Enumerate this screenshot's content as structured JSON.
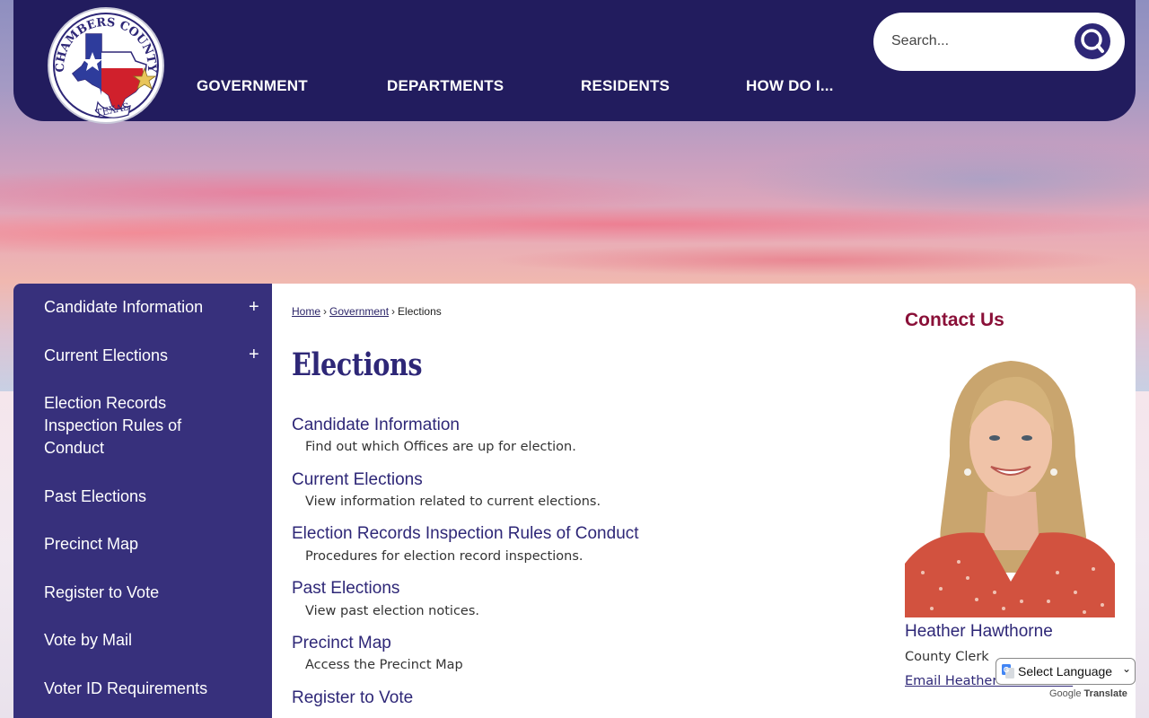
{
  "header": {
    "logo_text_top": "CHAMBERS COUNTY",
    "logo_text_bottom": "TEXAS",
    "nav": [
      "GOVERNMENT",
      "DEPARTMENTS",
      "RESIDENTS",
      "HOW DO I..."
    ],
    "search_placeholder": "Search..."
  },
  "sidebar": {
    "items": [
      {
        "label": "Candidate Information",
        "expandable": true,
        "expand_symbol": "+"
      },
      {
        "label": "Current Elections",
        "expandable": true,
        "expand_symbol": "+"
      },
      {
        "label": "Election Records Inspection Rules of Conduct",
        "expandable": false
      },
      {
        "label": "Past Elections",
        "expandable": false
      },
      {
        "label": "Precinct Map",
        "expandable": false
      },
      {
        "label": "Register to Vote",
        "expandable": false
      },
      {
        "label": "Vote by Mail",
        "expandable": false
      },
      {
        "label": "Voter ID Requirements",
        "expandable": false
      }
    ]
  },
  "breadcrumb": {
    "home": "Home",
    "government": "Government",
    "current": "Elections",
    "separator": "›"
  },
  "main": {
    "title": "Elections",
    "entries": [
      {
        "title": "Candidate Information",
        "desc": "Find out which Offices are up for election."
      },
      {
        "title": "Current Elections",
        "desc": "View information related to current elections."
      },
      {
        "title": "Election Records Inspection Rules of Conduct",
        "desc": "Procedures for election record inspections."
      },
      {
        "title": "Past Elections",
        "desc": "View past election notices."
      },
      {
        "title": "Precinct Map",
        "desc": "Access the Precinct Map"
      },
      {
        "title": "Register to Vote",
        "desc": ""
      }
    ]
  },
  "contact": {
    "heading": "Contact Us",
    "name": "Heather Hawthorne",
    "role": "County Clerk",
    "email_label": "Email Heather Hawthorne"
  },
  "translate": {
    "select_label": "Select Language",
    "powered_by": "Google",
    "translate_label": "Translate"
  },
  "colors": {
    "header_bg": "#221c5e",
    "sidebar_bg": "#37307c",
    "link": "#2e2777",
    "contact_heading": "#8a1038"
  }
}
